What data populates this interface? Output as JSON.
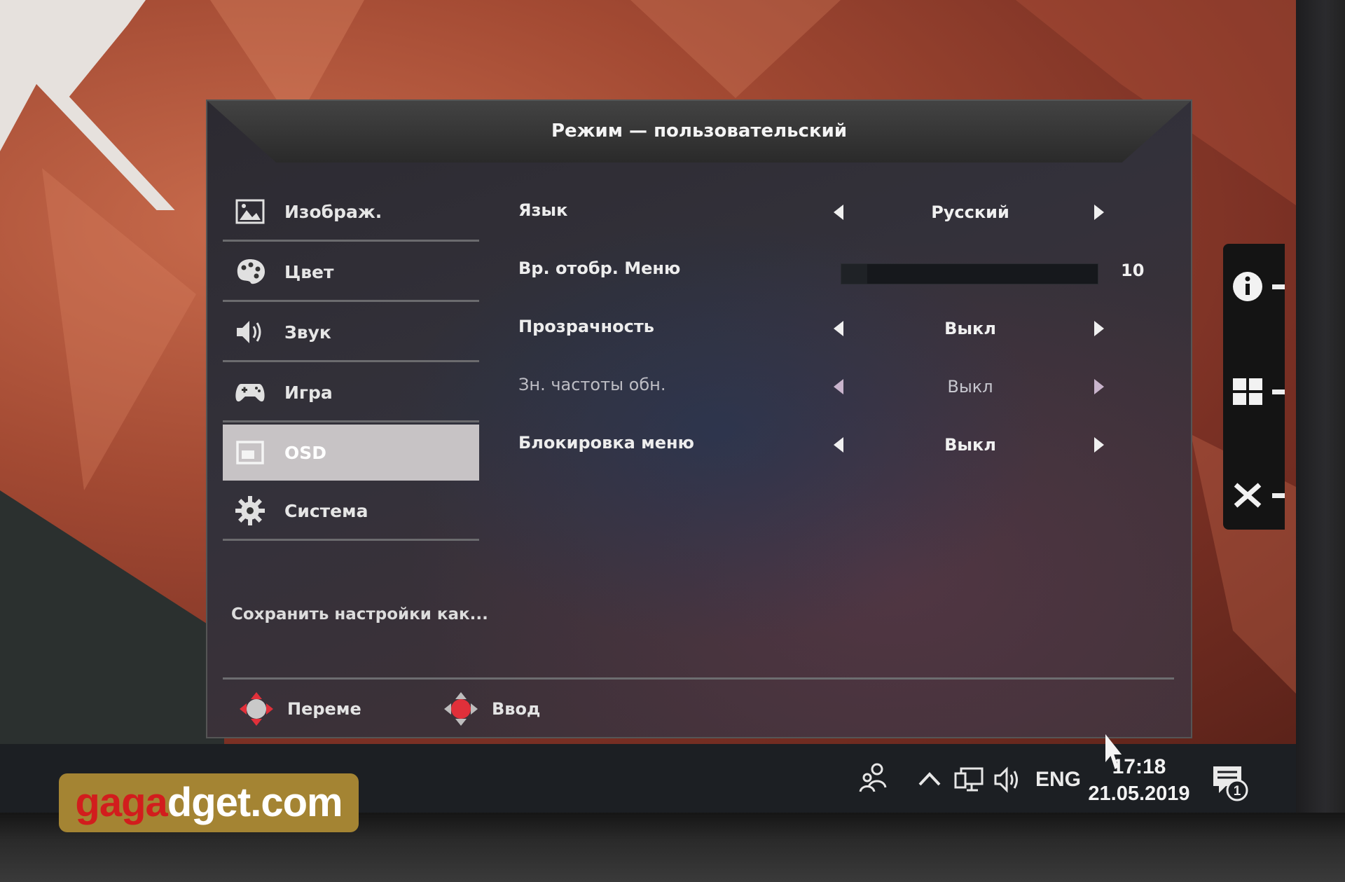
{
  "osd": {
    "title": "Режим — пользовательский",
    "menu": [
      {
        "label": "Изображ.",
        "icon": "image-icon",
        "active": false
      },
      {
        "label": "Цвет",
        "icon": "palette-icon",
        "active": false
      },
      {
        "label": "Звук",
        "icon": "speaker-icon",
        "active": false
      },
      {
        "label": "Игра",
        "icon": "gamepad-icon",
        "active": false
      },
      {
        "label": "OSD",
        "icon": "osd-window-icon",
        "active": true
      },
      {
        "label": "Система",
        "icon": "gear-icon",
        "active": false
      }
    ],
    "save_as": "Сохранить настройки как...",
    "settings": {
      "language": {
        "label": "Язык",
        "value": "Русский"
      },
      "menu_time": {
        "label": "Вр. отобр. Меню",
        "value": "10",
        "level": 0.1
      },
      "transparency": {
        "label": "Прозрачность",
        "value": "Выкл"
      },
      "refresh_rate": {
        "label": "Зн. частоты обн.",
        "value": "Выкл"
      },
      "menu_lock": {
        "label": "Блокировка меню",
        "value": "Выкл"
      }
    },
    "footer": {
      "move_label": "Переме",
      "enter_label": "Ввод"
    }
  },
  "side_keys": [
    {
      "icon": "info-icon"
    },
    {
      "icon": "grid-icon"
    },
    {
      "icon": "close-icon"
    }
  ],
  "taskbar": {
    "language": "ENG",
    "time": "17:18",
    "date": "21.05.2019",
    "notification_count": "1"
  },
  "watermark": {
    "prefix": "ga",
    "middle": "ga",
    "rest": "dget.com"
  },
  "colors": {
    "osd_active_item": "#c7c3c5",
    "dpad_accent": "#e0303a",
    "watermark_bg": "#a48433"
  }
}
